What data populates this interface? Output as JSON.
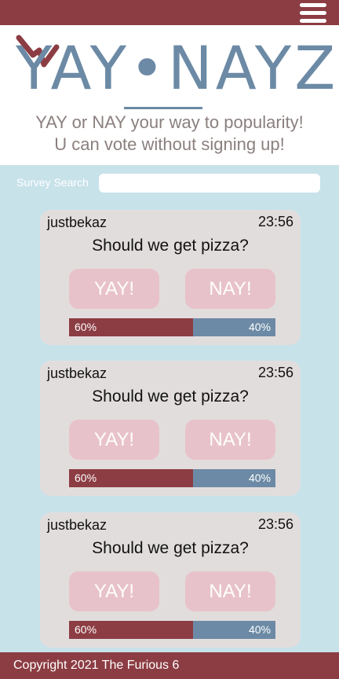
{
  "brand": {
    "logo_text": "YAY•NAYZ",
    "tagline_line1": "YAY or NAY your way to popularity!",
    "tagline_line2": "U can vote without signing up!"
  },
  "colors": {
    "maroon": "#8c3d43",
    "steel_blue": "#6c8aa5",
    "page_bg": "#c8e2ea",
    "card_bg": "#e2dddd",
    "button_pink": "#e8c2ca"
  },
  "search": {
    "label": "Survey Search",
    "value": "",
    "placeholder": ""
  },
  "surveys": [
    {
      "user": "justbekaz",
      "time": "23:56",
      "question": "Should we get pizza?",
      "yay_label": "YAY!",
      "nay_label": "NAY!",
      "yay_percent": 60,
      "nay_percent": 40,
      "yay_text": "60%",
      "nay_text": "40%"
    },
    {
      "user": "justbekaz",
      "time": "23:56",
      "question": "Should we get pizza?",
      "yay_label": "YAY!",
      "nay_label": "NAY!",
      "yay_percent": 60,
      "nay_percent": 40,
      "yay_text": "60%",
      "nay_text": "40%"
    },
    {
      "user": "justbekaz",
      "time": "23:56",
      "question": "Should we get pizza?",
      "yay_label": "YAY!",
      "nay_label": "NAY!",
      "yay_percent": 60,
      "nay_percent": 40,
      "yay_text": "60%",
      "nay_text": "40%"
    }
  ],
  "footer": {
    "copyright": "Copyright 2021 The Furious 6"
  }
}
